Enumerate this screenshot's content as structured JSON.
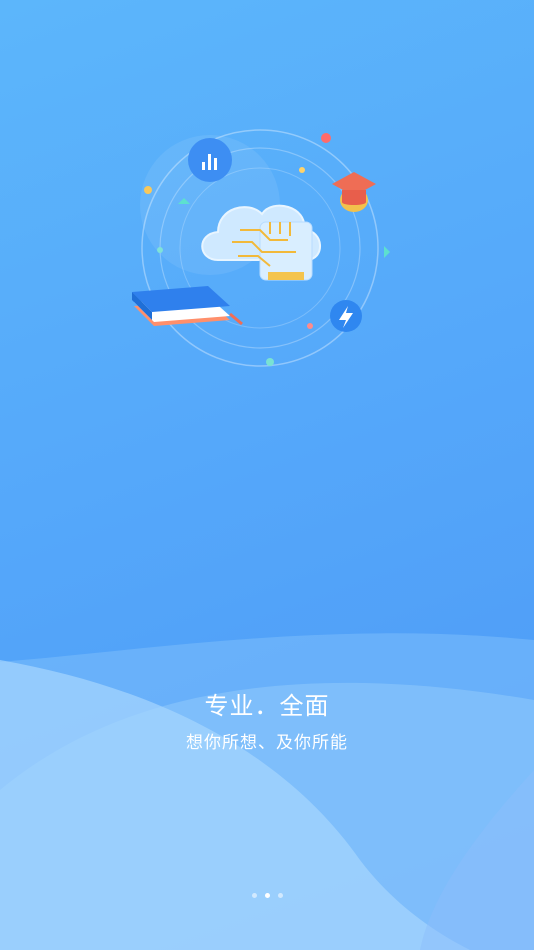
{
  "onboarding": {
    "title": "专业．全面",
    "subtitle": "想你所想、及你所能",
    "pager": {
      "current_page": 2,
      "total_pages": 3
    }
  },
  "illustration": {
    "icons": [
      "bar-chart-icon",
      "graduation-cap-icon",
      "lightning-icon",
      "books-icon",
      "cloud-chip-icon"
    ]
  },
  "colors": {
    "background_top": "#5cb6fb",
    "background_bottom": "#4c97f6",
    "text": "#ffffff"
  }
}
